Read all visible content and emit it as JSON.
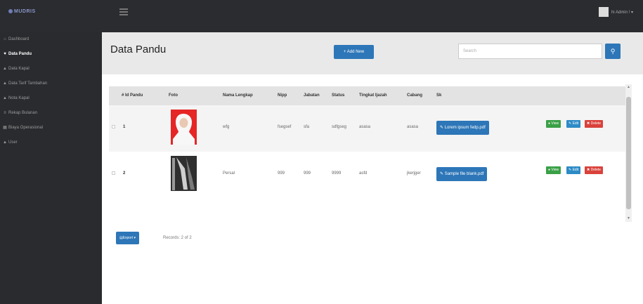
{
  "topbar": {
    "logo": "MUDRIS",
    "user_label": "hi Admin ! ▾"
  },
  "sidebar": {
    "items": [
      {
        "label": "Dashboard",
        "icon": "⌂",
        "active": false
      },
      {
        "label": "Data Pandu",
        "icon": "♥",
        "active": true
      },
      {
        "label": "Data Kapal",
        "icon": "▲",
        "active": false
      },
      {
        "label": "Data Tarif Tambahan",
        "icon": "▲",
        "active": false
      },
      {
        "label": "Nota Kapal",
        "icon": "▲",
        "active": false
      },
      {
        "label": "Rekap Bulanan",
        "icon": "≡",
        "active": false
      },
      {
        "label": "Biaya Operasional",
        "icon": "▦",
        "active": false
      },
      {
        "label": "User",
        "icon": "▲",
        "active": false
      }
    ]
  },
  "header": {
    "title": "Data Pandu",
    "add_new_label": "+ Add New",
    "search_placeholder": "Search",
    "search_icon": "search-icon"
  },
  "table": {
    "columns": [
      "# Id Pandu",
      "Foto",
      "Nama Lengkap",
      "Nipp",
      "Jabatan",
      "Status",
      "Tingkat Ijazah",
      "Cabang",
      "Sk"
    ],
    "rows": [
      {
        "id": "1",
        "nama": "wfg",
        "nipp": "fsegsef",
        "jabatan": "sfa",
        "status": "sdfgseg",
        "ijazah": "asasa",
        "cabang": "asasa",
        "sk": "Lorem ipsum fedp.pdf"
      },
      {
        "id": "2",
        "nama": "Persal",
        "nipp": "999",
        "jabatan": "999",
        "status": "9999",
        "ijazah": "asfd",
        "cabang": "jkerjger",
        "sk": "Sample file blank.pdf"
      }
    ],
    "actions": {
      "view": "View",
      "edit": "Edit",
      "delete": "Delete"
    }
  },
  "footer": {
    "export_label": "Export ▾",
    "records_text": "Records: 2 of 2"
  },
  "colors": {
    "topbar": "#2b2c30",
    "sidebar": "#2a2b2f",
    "primary": "#2d76b8",
    "success": "#3aa046",
    "danger": "#d9423b"
  }
}
